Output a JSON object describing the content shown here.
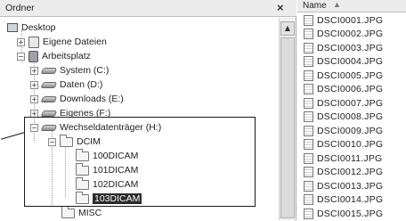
{
  "folder_pane": {
    "title": "Ordner",
    "close": "×"
  },
  "tree": [
    {
      "label": "Desktop",
      "icon": "desktop-icon"
    },
    {
      "label": "Eigene Dateien",
      "icon": "documents-icon",
      "expander": "+"
    },
    {
      "label": "Arbeitsplatz",
      "icon": "computer-icon",
      "expander": "−"
    },
    {
      "label": "System (C:)",
      "icon": "drive-icon",
      "expander": "+"
    },
    {
      "label": "Daten (D:)",
      "icon": "drive-icon",
      "expander": "+"
    },
    {
      "label": "Downloads (E:)",
      "icon": "drive-icon",
      "expander": "+"
    },
    {
      "label": "Eigenes (F:)",
      "icon": "drive-icon",
      "expander": "+"
    },
    {
      "label": "Wechseldatenträger (H:)",
      "icon": "drive-icon",
      "expander": "−"
    },
    {
      "label": "DCIM",
      "icon": "folder-icon",
      "expander": "−"
    },
    {
      "label": "100DICAM",
      "icon": "folder-icon"
    },
    {
      "label": "101DICAM",
      "icon": "folder-icon"
    },
    {
      "label": "102DICAM",
      "icon": "folder-icon"
    },
    {
      "label": "103DICAM",
      "icon": "folder-icon",
      "selected": true
    },
    {
      "label": "MISC",
      "icon": "folder-icon"
    }
  ],
  "scrollbar": {
    "up_arrow": "▲"
  },
  "file_pane": {
    "header": "Name",
    "sort_arrow": "▲",
    "files": [
      "DSCI0001.JPG",
      "DSCI0002.JPG",
      "DSCI0003.JPG",
      "DSCI0004.JPG",
      "DSCI0005.JPG",
      "DSCI0006.JPG",
      "DSCI0007.JPG",
      "DSCI0008.JPG",
      "DSCI0009.JPG",
      "DSCI0010.JPG",
      "DSCI0011.JPG",
      "DSCI0012.JPG",
      "DSCI0013.JPG",
      "DSCI0014.JPG",
      "DSCI0015.JPG"
    ]
  },
  "colors": {
    "selection_bg": "#2a2a2a",
    "selection_fg": "#ffffff",
    "header_bg": "#ececec"
  }
}
